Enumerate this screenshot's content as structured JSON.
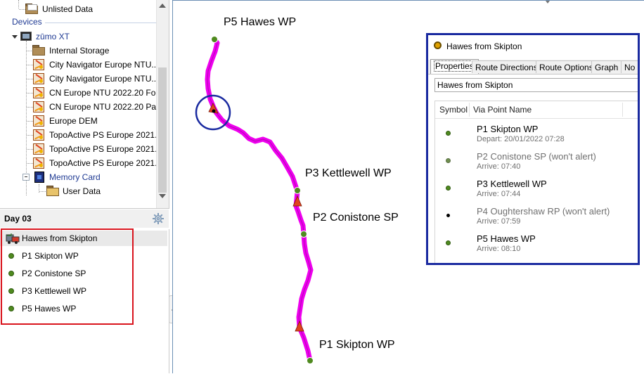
{
  "tree": {
    "items": [
      {
        "label": "Unlisted Data",
        "icon": "folder-icon"
      },
      {
        "label": "zūmo XT",
        "icon": "device-icon"
      },
      {
        "label": "Internal Storage",
        "icon": "folder-icon"
      },
      {
        "label": "City Navigator Europe NTU...",
        "icon": "map-icon"
      },
      {
        "label": "City Navigator Europe NTU...",
        "icon": "map-icon"
      },
      {
        "label": "CN Europe NTU 2022.20 Fo...",
        "icon": "map-icon"
      },
      {
        "label": "CN Europe NTU 2022.20 Pa...",
        "icon": "map-icon"
      },
      {
        "label": "Europe DEM",
        "icon": "map-icon"
      },
      {
        "label": "TopoActive PS Europe 2021...",
        "icon": "map-icon"
      },
      {
        "label": "TopoActive PS Europe 2021...",
        "icon": "map-icon"
      },
      {
        "label": "TopoActive PS Europe 2021...",
        "icon": "map-icon"
      },
      {
        "label": "Memory Card",
        "icon": "sd-card-icon"
      },
      {
        "label": "User Data",
        "icon": "folder-icon"
      }
    ],
    "devices_header": "Devices"
  },
  "day": {
    "title": "Day 03",
    "route_name": "Hawes from Skipton",
    "waypoints": [
      "P1 Skipton WP",
      "P2 Conistone SP",
      "P3 Kettlewell WP",
      "P5 Hawes WP"
    ]
  },
  "map": {
    "labels": {
      "p5": "P5 Hawes WP",
      "p3": "P3 Kettlewell WP",
      "p2": "P2 Conistone SP",
      "p1": "P1 Skipton WP"
    },
    "route_color": "#ee00ee",
    "waypoint_color": "#4f8a1f",
    "highlight_color": "#1a2aa0"
  },
  "props": {
    "title": "Hawes from Skipton",
    "tabs": [
      "Properties",
      "Route Directions",
      "Route Options",
      "Graph",
      "No"
    ],
    "name_value": "Hawes from Skipton",
    "col_symbol": "Symbol",
    "col_name": "Via Point Name",
    "via_points": [
      {
        "name": "P1 Skipton WP",
        "sub": "Depart: 20/01/2022 07:28",
        "muted": false,
        "symbol": "green-dot"
      },
      {
        "name": "P2 Conistone SP (won't alert)",
        "sub": "Arrive: 07:40",
        "muted": true,
        "symbol": "green-dot"
      },
      {
        "name": "P3 Kettlewell WP",
        "sub": "Arrive: 07:44",
        "muted": false,
        "symbol": "green-dot"
      },
      {
        "name": "P4 Oughtershaw RP (won't alert)",
        "sub": "Arrive: 07:59",
        "muted": true,
        "symbol": "black-dot"
      },
      {
        "name": "P5 Hawes WP",
        "sub": "Arrive: 08:10",
        "muted": false,
        "symbol": "green-dot"
      }
    ]
  },
  "colors": {
    "selection_box": "#d9141d",
    "window_border": "#1a2aa0",
    "devices_header": "#1f3a93"
  }
}
